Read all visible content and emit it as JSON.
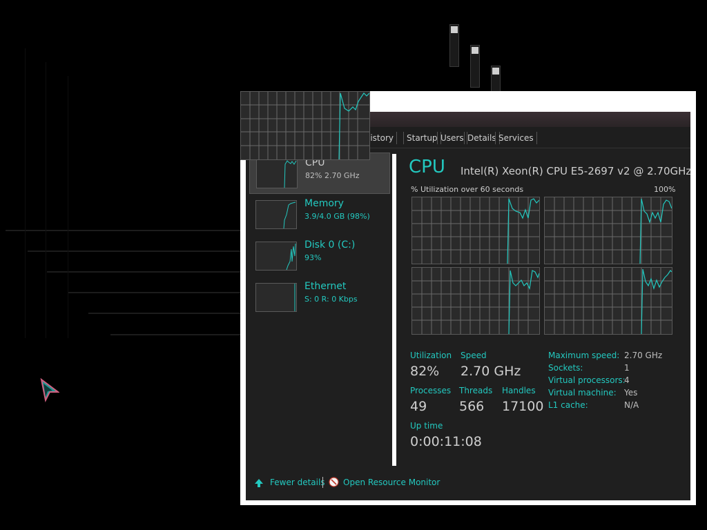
{
  "tabs": [
    "History",
    "Startup",
    "Users",
    "Details",
    "Services"
  ],
  "tabs_visible_text": [
    "listory",
    "Startup",
    "Users",
    "Details",
    "Services"
  ],
  "sidebar": {
    "items": [
      {
        "title": "CPU",
        "sub": "82%  2.70 GHz"
      },
      {
        "title": "Memory",
        "sub": "3.9/4.0 GB (98%)"
      },
      {
        "title": "Disk 0 (C:)",
        "sub": "93%"
      },
      {
        "title": "Ethernet",
        "sub": "S: 0 R: 0 Kbps"
      }
    ]
  },
  "cpu": {
    "title": "CPU",
    "model": "Intel(R) Xeon(R) CPU E5-2697 v2 @ 2.70GHz",
    "graph_caption": "% Utilization over 60 seconds",
    "graph_max": "100%",
    "stats": {
      "utilization_label": "Utilization",
      "utilization_value": "82%",
      "speed_label": "Speed",
      "speed_value": "2.70 GHz",
      "processes_label": "Processes",
      "processes_value": "49",
      "threads_label": "Threads",
      "threads_value": "566",
      "handles_label": "Handles",
      "handles_value": "17100",
      "uptime_label": "Up time",
      "uptime_value": "0:00:11:08"
    },
    "details": [
      {
        "key": "Maximum speed:",
        "value": "2.70 GHz"
      },
      {
        "key": "Sockets:",
        "value": "1"
      },
      {
        "key": "Virtual processors:",
        "value": "4"
      },
      {
        "key": "Virtual machine:",
        "value": "Yes"
      },
      {
        "key": "L1 cache:",
        "value": "N/A"
      }
    ]
  },
  "footer": {
    "fewer_details": "Fewer details",
    "open_resource_monitor": "Open Resource Monitor"
  },
  "icons": {
    "fewer_details": "arrow-up-icon",
    "resource_monitor": "resource-monitor-icon"
  },
  "colors": {
    "accent": "#23c9c0",
    "background": "#1f1f1f",
    "text": "#cfcfcf"
  }
}
